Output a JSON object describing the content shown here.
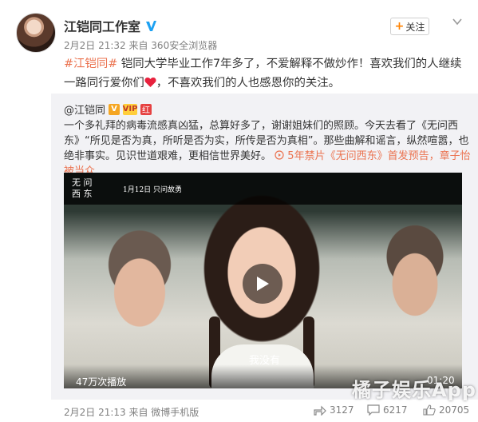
{
  "header": {
    "name": "江铠同工作室",
    "meta": "2月2日 21:32 来自 360安全浏览器",
    "follow_label": "关注"
  },
  "post": {
    "topic": "#江铠同#",
    "text_part1": " 铠同大学毕业工作7年多了，不爱解释不做炒作！喜欢我们的人继续一路同行爱你们",
    "text_part2": "，不喜欢我们的人也感恩你的关注。"
  },
  "repost": {
    "user": "@江铠同",
    "badges": [
      "V",
      "VIP",
      "红"
    ],
    "text": "一个多礼拜的病毒流感真凶猛，总算好多了，谢谢姐妹们的照顾。今天去看了《无问西东》“所见是否为真，所听是否为实，所传是否为真相”。那些曲解和谣言，纵然喧嚣，也绝非事实。见识世道艰难，更相信世界美好。",
    "link_text": "5年禁片《无问西东》首发预告，章子怡被当众..."
  },
  "video": {
    "title_line1": "无 问",
    "title_line2": "西 东",
    "date_text": "1月12日 只问故勇",
    "subtitle": "我没有",
    "views": "47万次播放",
    "duration": "01:20"
  },
  "footer": {
    "meta": "2月2日 21:13 来自 微博手机版",
    "shares": "3127",
    "comments": "6217",
    "likes": "20705"
  },
  "watermark": "橘子娱乐App",
  "colors": {
    "topic": "#eb7350",
    "follow_plus": "#ff8200",
    "verified": "#1da1f2",
    "repost_bg": "#f2f2f5"
  }
}
